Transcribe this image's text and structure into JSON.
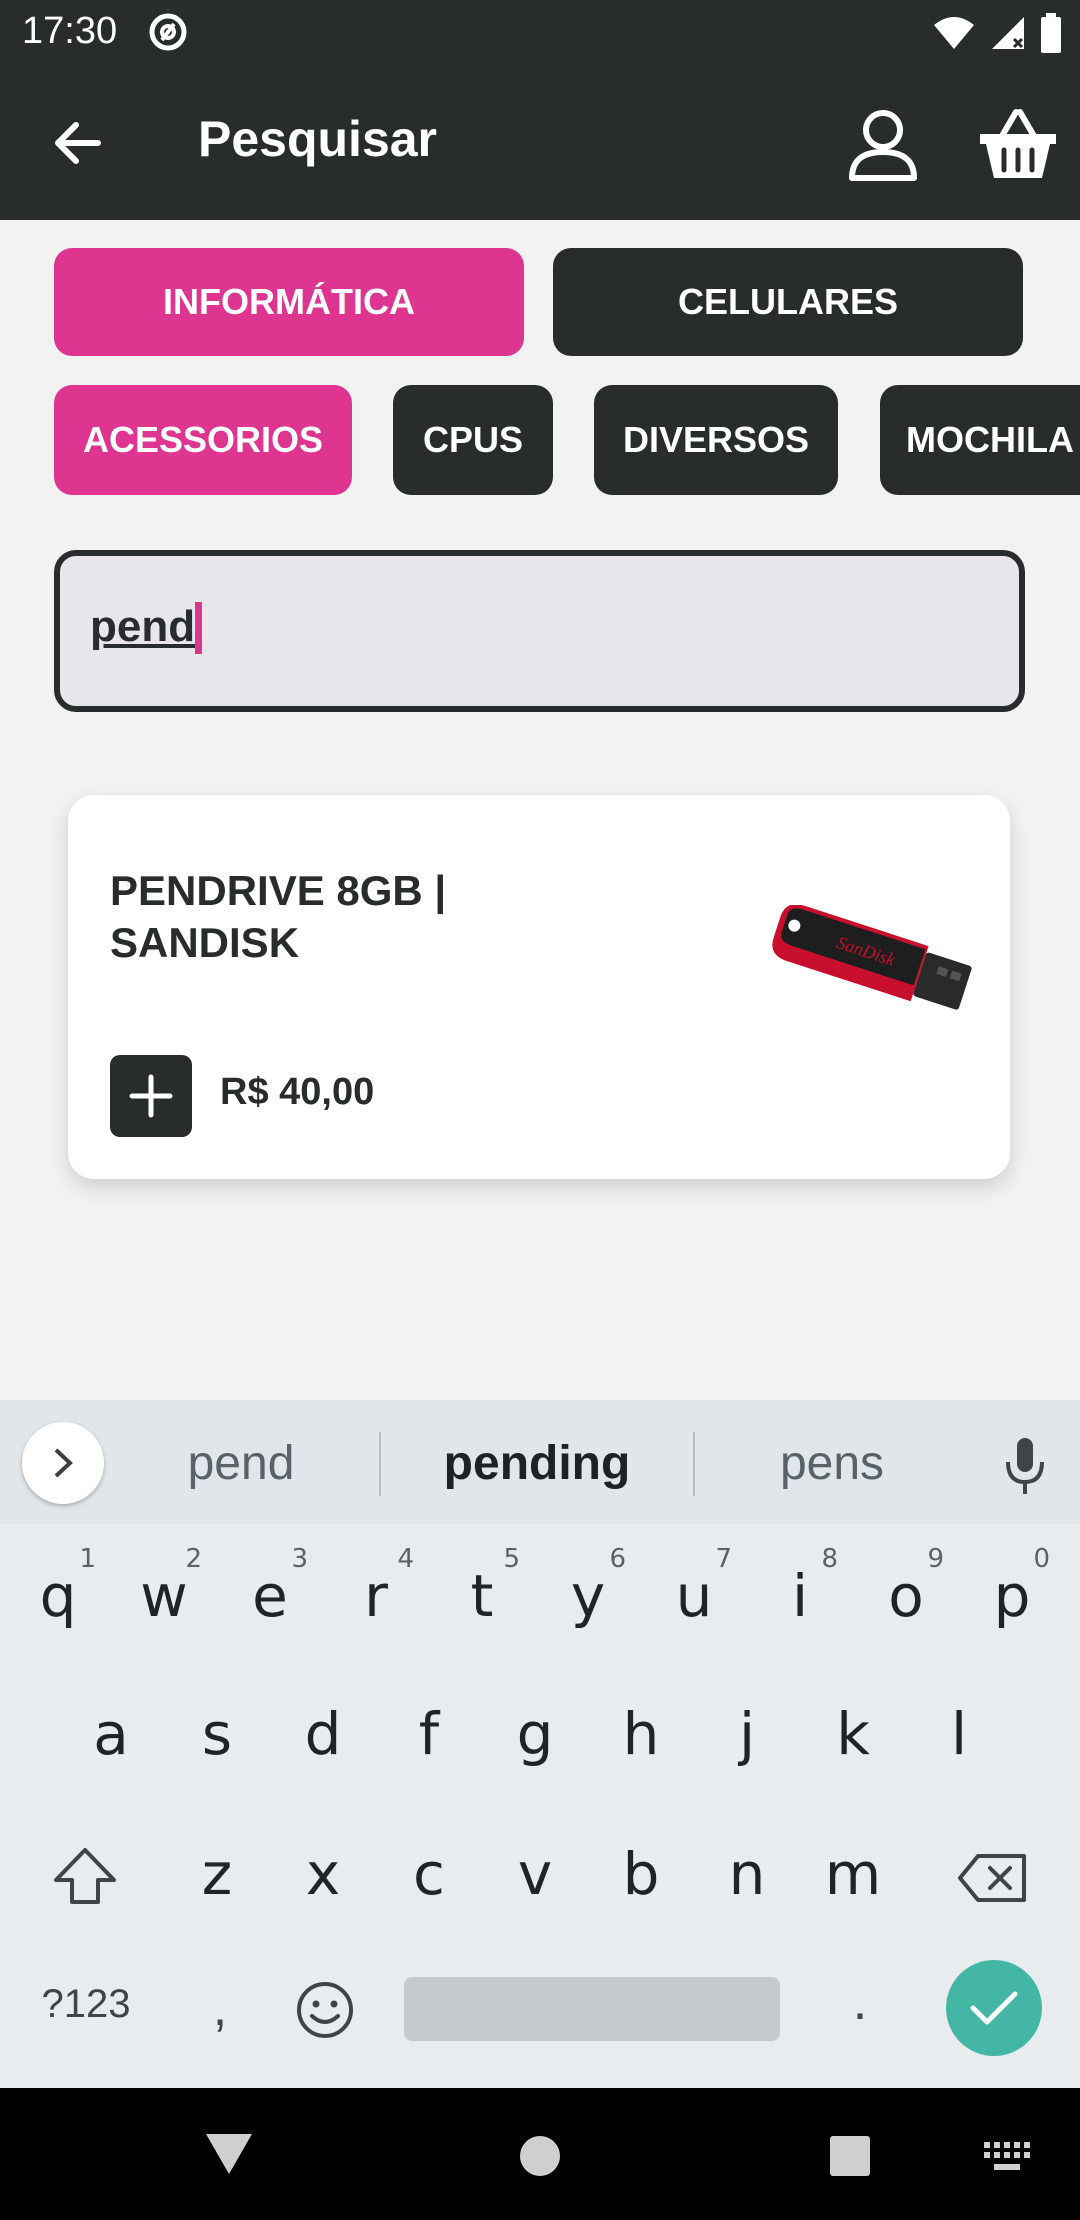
{
  "status": {
    "time": "17:30"
  },
  "app_bar": {
    "title": "Pesquisar"
  },
  "categories": [
    {
      "label": "INFORMÁTICA",
      "active": true
    },
    {
      "label": "CELULARES",
      "active": false
    }
  ],
  "subcategories": [
    {
      "label": "ACESSORIOS",
      "active": true
    },
    {
      "label": "CPUS",
      "active": false
    },
    {
      "label": "DIVERSOS",
      "active": false
    },
    {
      "label": "MOCHILA",
      "active": false
    }
  ],
  "search": {
    "value": "pend"
  },
  "product": {
    "name": "PENDRIVE 8GB | SANDISK",
    "price": "R$ 40,00",
    "brand_text": "SanDisk"
  },
  "keyboard": {
    "suggestions": [
      "pend",
      "pending",
      "pens"
    ],
    "row1": [
      "q",
      "w",
      "e",
      "r",
      "t",
      "y",
      "u",
      "i",
      "o",
      "p"
    ],
    "row1_nums": [
      "1",
      "2",
      "3",
      "4",
      "5",
      "6",
      "7",
      "8",
      "9",
      "0"
    ],
    "row2": [
      "a",
      "s",
      "d",
      "f",
      "g",
      "h",
      "j",
      "k",
      "l"
    ],
    "row3": [
      "z",
      "x",
      "c",
      "v",
      "b",
      "n",
      "m"
    ],
    "symbols_label": "?123",
    "comma": ",",
    "period": "."
  },
  "colors": {
    "accent": "#de3591",
    "dark": "#292c2c",
    "enter": "#43b7a4"
  }
}
